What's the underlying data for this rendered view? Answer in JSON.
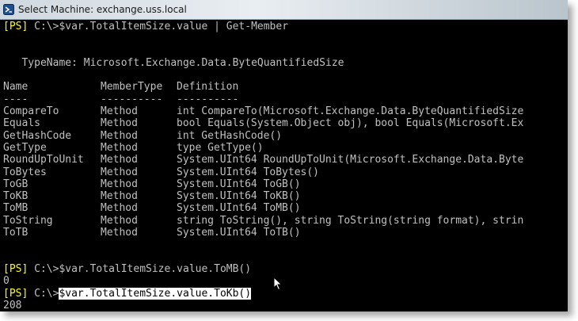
{
  "window": {
    "title": "Select Machine: exchange.uss.local"
  },
  "prompt": "[PS]",
  "path": " C:\\>",
  "console": {
    "cmd1": "$var.TotalItemSize.value | Get-Member",
    "typename_line": "   TypeName: Microsoft.Exchange.Data.ByteQuantifiedSize",
    "headers": [
      "Name",
      "MemberType",
      "Definition"
    ],
    "header_underline": [
      "----",
      "----------",
      "----------"
    ],
    "members": [
      {
        "name": "CompareTo",
        "type": "Method",
        "def": "int CompareTo(Microsoft.Exchange.Data.ByteQuantifiedSize"
      },
      {
        "name": "Equals",
        "type": "Method",
        "def": "bool Equals(System.Object obj), bool Equals(Microsoft.Ex"
      },
      {
        "name": "GetHashCode",
        "type": "Method",
        "def": "int GetHashCode()"
      },
      {
        "name": "GetType",
        "type": "Method",
        "def": "type GetType()"
      },
      {
        "name": "RoundUpToUnit",
        "type": "Method",
        "def": "System.UInt64 RoundUpToUnit(Microsoft.Exchange.Data.Byte"
      },
      {
        "name": "ToBytes",
        "type": "Method",
        "def": "System.UInt64 ToBytes()"
      },
      {
        "name": "ToGB",
        "type": "Method",
        "def": "System.UInt64 ToGB()"
      },
      {
        "name": "ToKB",
        "type": "Method",
        "def": "System.UInt64 ToKB()"
      },
      {
        "name": "ToMB",
        "type": "Method",
        "def": "System.UInt64 ToMB()"
      },
      {
        "name": "ToString",
        "type": "Method",
        "def": "string ToString(), string ToString(string format), strin"
      },
      {
        "name": "ToTB",
        "type": "Method",
        "def": "System.UInt64 ToTB()"
      }
    ],
    "cmd2": "$var.TotalItemSize.value.ToMB()",
    "out2": "0",
    "cmd3": "$var.TotalItemSize.value.ToKb()",
    "out3": "208"
  },
  "colors": {
    "prompt": "#ffff00",
    "text": "#c0c0c0",
    "background": "#000000"
  },
  "icons": [
    "powershell-app-icon",
    "mouse-pointer-icon"
  ]
}
